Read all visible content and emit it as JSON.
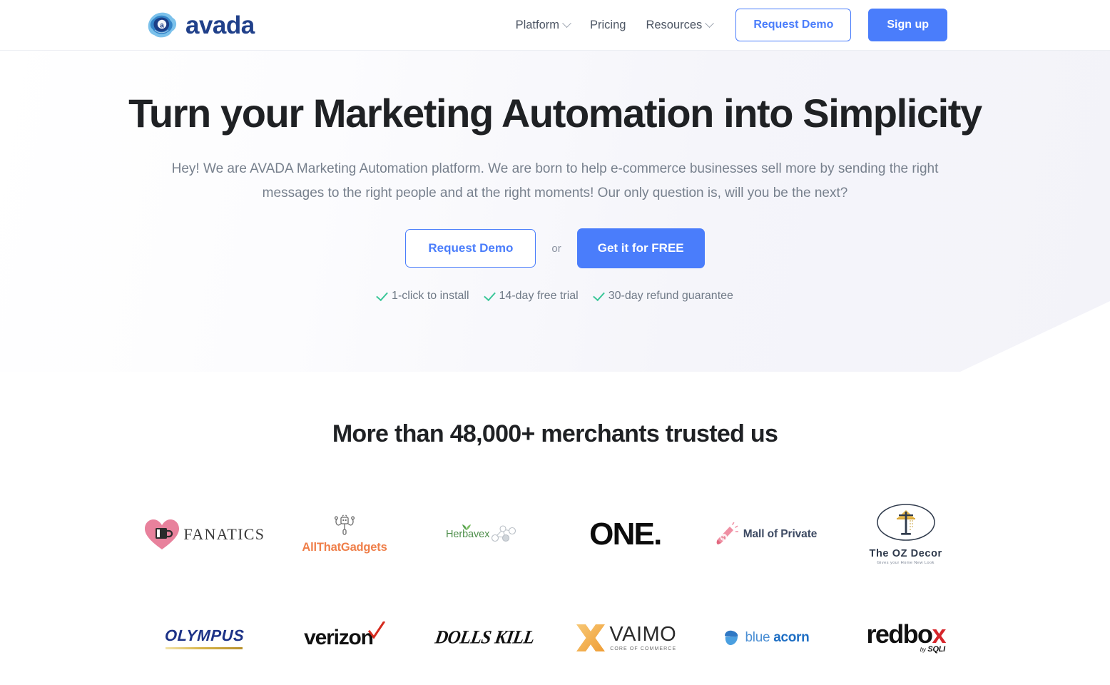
{
  "header": {
    "logo": {
      "text": "avada",
      "icon": "avada-cloud-logo"
    },
    "nav": [
      {
        "label": "Platform",
        "has_caret": true
      },
      {
        "label": "Pricing",
        "has_caret": false
      },
      {
        "label": "Resources",
        "has_caret": true
      }
    ],
    "request_demo_label": "Request Demo",
    "signup_label": "Sign up"
  },
  "hero": {
    "title": "Turn your Marketing Automation into Simplicity",
    "subtitle": "Hey! We are AVADA Marketing Automation platform. We are born to help e-commerce businesses sell more by sending the right messages to the right people and at the right moments! Our only question is, will you be the next?",
    "request_demo_label": "Request Demo",
    "or_label": "or",
    "get_free_label": "Get it for FREE",
    "features": [
      "1-click to install",
      "14-day free trial",
      "30-day refund guarantee"
    ]
  },
  "merchants": {
    "title": "More than 48,000+ merchants trusted us",
    "logos": [
      {
        "name": "FANATICS",
        "icon": "heart-mug-icon"
      },
      {
        "name": "AllThatGadgets",
        "icon": "robot-icon"
      },
      {
        "name": "Herbavex",
        "icon": "sprout-molecule-icon"
      },
      {
        "name": "ONE.",
        "icon": ""
      },
      {
        "name": "Mall of Private",
        "icon": "megaphone-percent-icon"
      },
      {
        "name": "The OZ Decor",
        "tagline": "Gives your Home New Look",
        "icon": "lamp-oval-icon"
      },
      {
        "name": "OLYMPUS",
        "icon": ""
      },
      {
        "name": "verizon",
        "icon": "red-check-icon"
      },
      {
        "name": "DOLLS KILL",
        "icon": ""
      },
      {
        "name": "VAIMO",
        "tagline": "CORE OF COMMERCE",
        "icon": "orange-x-icon"
      },
      {
        "name": "blue acorn",
        "name_light": "blue",
        "name_bold": "acorn",
        "icon": "acorn-icon"
      },
      {
        "name": "redbox",
        "name_prefix": "redbo",
        "name_accent": "x",
        "sub_by": "by",
        "sub_brand": "SQLI"
      }
    ]
  },
  "colors": {
    "brand_blue": "#4a7dfb",
    "logo_navy": "#20408a",
    "check_green": "#3dc79a",
    "hero_bg": "#f3f3f9",
    "text_dark": "#1f2124",
    "text_muted": "#77808d"
  }
}
